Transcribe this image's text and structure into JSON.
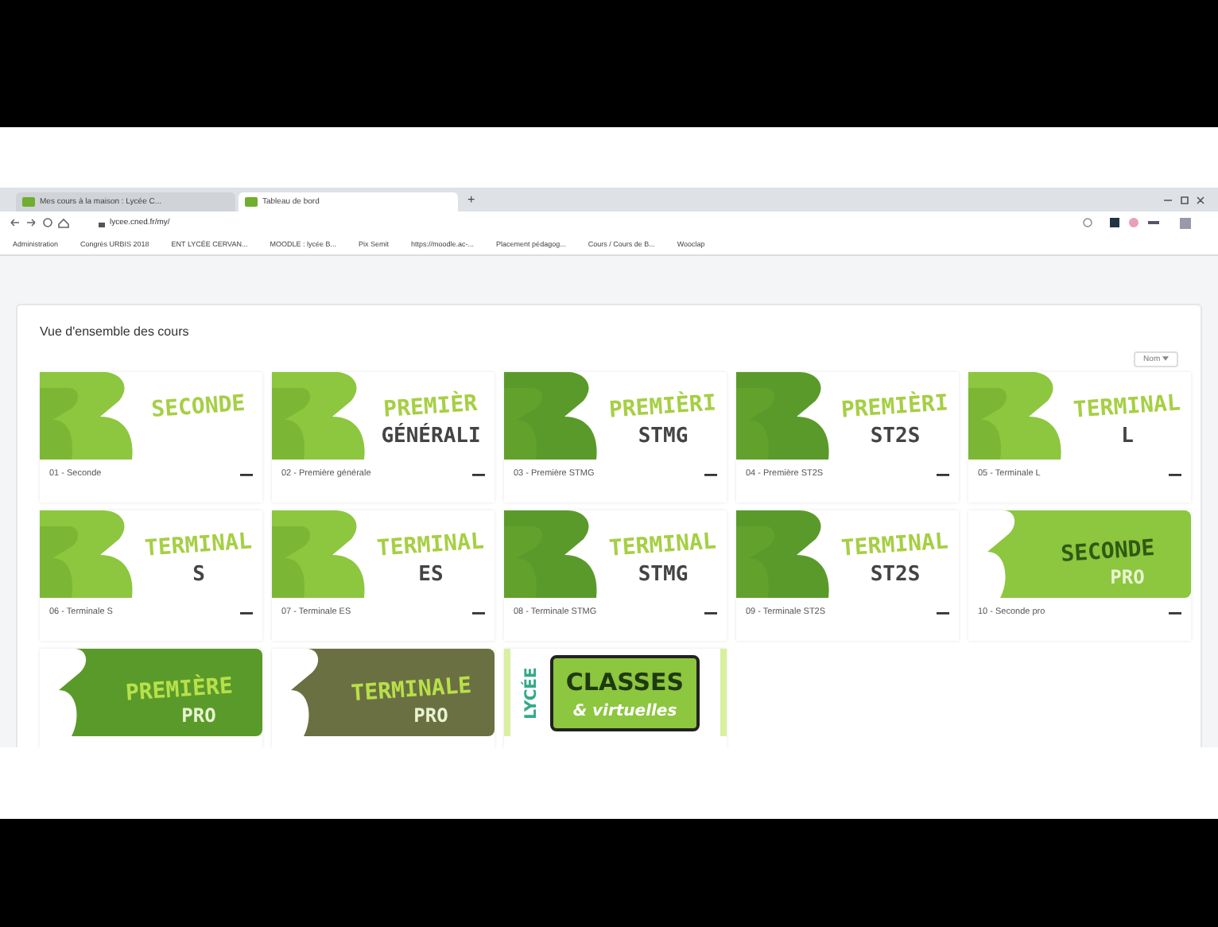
{
  "browser": {
    "tabs": [
      {
        "title": "Mes cours à la maison : Lycée C...",
        "selected": false
      },
      {
        "title": "Tableau de bord",
        "selected": true
      }
    ],
    "new_tab": "+",
    "url": "lycee.cned.fr/my/",
    "bookmarks": [
      "Administration",
      "Congrès URBIS 2018",
      "ENT LYCÉE CERVAN...",
      "MOODLE : lycée B...",
      "Pix Semit",
      "https://moodle.ac-...",
      "Placement pédagog...",
      "Cours / Cours de B...",
      "Wooclap"
    ]
  },
  "overview": {
    "title": "Vue d'ensemble des cours",
    "sort_button": "Nom",
    "courses": [
      {
        "caption": "01 - Seconde",
        "image": {
          "kind": "banner",
          "color": "#8dc63f",
          "title": "SECONDE"
        }
      },
      {
        "caption": "02 - Première générale",
        "image": {
          "kind": "banner",
          "color": "#8dc63f",
          "title": "PREMIÈR",
          "subtitle": "GÉNÉRALI"
        }
      },
      {
        "caption": "03 - Première STMG",
        "image": {
          "kind": "banner",
          "color": "#5a9a2a",
          "title": "PREMIÈRI",
          "subtitle": "STMG"
        }
      },
      {
        "caption": "04 - Première ST2S",
        "image": {
          "kind": "banner",
          "color": "#5a9a2a",
          "title": "PREMIÈRI",
          "subtitle": "ST2S"
        }
      },
      {
        "caption": "05 - Terminale L",
        "image": {
          "kind": "banner",
          "color": "#8dc63f",
          "title": "TERMINAL",
          "subtitle": "L"
        }
      },
      {
        "caption": "06 - Terminale S",
        "image": {
          "kind": "banner",
          "color": "#8dc63f",
          "title": "TERMINAL",
          "subtitle": "S"
        }
      },
      {
        "caption": "07 - Terminale ES",
        "image": {
          "kind": "banner",
          "color": "#8dc63f",
          "title": "TERMINAL",
          "subtitle": "ES"
        }
      },
      {
        "caption": "08 - Terminale STMG",
        "image": {
          "kind": "banner",
          "color": "#5a9a2a",
          "title": "TERMINAL",
          "subtitle": "STMG"
        }
      },
      {
        "caption": "09 - Terminale ST2S",
        "image": {
          "kind": "banner",
          "color": "#5a9a2a",
          "title": "TERMINAL",
          "subtitle": "ST2S"
        }
      },
      {
        "caption": "10 - Seconde pro",
        "image": {
          "kind": "pro",
          "color": "#8dc63f",
          "title": "SECONDE",
          "subtitle": "PRO"
        }
      },
      {
        "image": {
          "kind": "pro",
          "color": "#5a9a2a",
          "title": "PREMIÈRE",
          "subtitle": "PRO"
        }
      },
      {
        "image": {
          "kind": "pro",
          "color": "#6b7042",
          "title": "TERMINALE",
          "subtitle": "PRO"
        }
      },
      {
        "image": {
          "kind": "logo",
          "color": "#8dc63f",
          "title": "CLASSES",
          "subtitle": "& virtuelles",
          "side": "LYCÉE"
        }
      }
    ]
  }
}
